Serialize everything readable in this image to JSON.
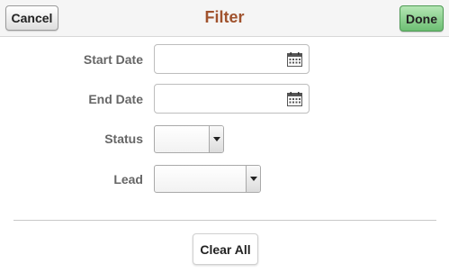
{
  "header": {
    "title": "Filter",
    "cancel_label": "Cancel",
    "done_label": "Done"
  },
  "form": {
    "start_date": {
      "label": "Start Date",
      "value": "",
      "icon": "calendar-icon"
    },
    "end_date": {
      "label": "End Date",
      "value": "",
      "icon": "calendar-icon"
    },
    "status": {
      "label": "Status",
      "selected": ""
    },
    "lead": {
      "label": "Lead",
      "selected": ""
    }
  },
  "footer": {
    "clear_all_label": "Clear All"
  },
  "colors": {
    "title": "#a0522d",
    "done_button": "#6dbf73",
    "label": "#666666"
  }
}
